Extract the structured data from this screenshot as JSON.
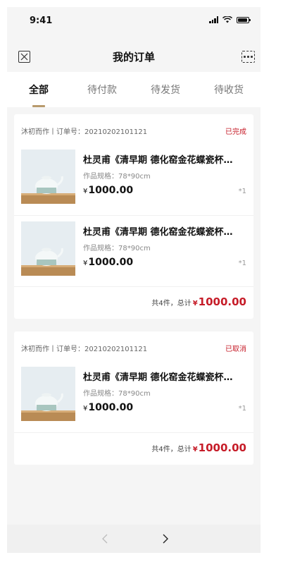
{
  "status_bar": {
    "time": "9:41"
  },
  "header": {
    "title": "我的订单"
  },
  "tabs": [
    {
      "label": "全部",
      "active": true
    },
    {
      "label": "待付款",
      "active": false
    },
    {
      "label": "待发货",
      "active": false
    },
    {
      "label": "待收货",
      "active": false
    }
  ],
  "orders": [
    {
      "shop_order": "沐初而作丨订单号：20210202101121",
      "status": "已完成",
      "items": [
        {
          "name": "杜灵甫《清早期 德化窑金花蝶瓷杯…",
          "spec": "作品规格：78*90cm",
          "currency": "¥",
          "price": "1000.00",
          "qty": "*1"
        },
        {
          "name": "杜灵甫《清早期 德化窑金花蝶瓷杯…",
          "spec": "作品规格：78*90cm",
          "currency": "¥",
          "price": "1000.00",
          "qty": "*1"
        }
      ],
      "summary_label": "共4件，总计",
      "total_currency": "¥",
      "total": "1000.00"
    },
    {
      "shop_order": "沐初而作丨订单号：20210202101121",
      "status": "已取消",
      "items": [
        {
          "name": "杜灵甫《清早期 德化窑金花蝶瓷杯…",
          "spec": "作品规格：78*90cm",
          "currency": "¥",
          "price": "1000.00",
          "qty": "*1"
        }
      ],
      "summary_label": "共4件，总计",
      "total_currency": "¥",
      "total": "1000.00"
    }
  ],
  "colors": {
    "accent": "#c61c28",
    "tab_indicator": "#b89a6c",
    "background": "#f5f5f5"
  },
  "icons": {
    "close": "close-icon",
    "more": "more-icon",
    "back": "chevron-left-icon",
    "forward": "chevron-right-icon"
  }
}
